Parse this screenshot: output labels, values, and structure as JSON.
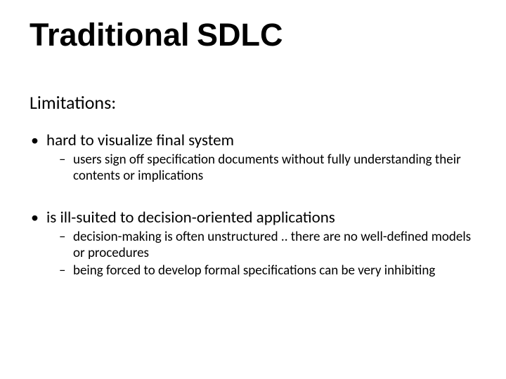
{
  "title": "Traditional SDLC",
  "subhead": "Limitations:",
  "points": [
    {
      "text": "hard to visualize final system",
      "sub": [
        "users sign off specification documents without fully understanding their contents or implications"
      ]
    },
    {
      "text": "is ill-suited to decision-oriented applications",
      "sub": [
        "decision-making is often unstructured .. there are no well-defined models or procedures",
        "being forced to develop formal specifications can be very inhibiting"
      ]
    }
  ]
}
